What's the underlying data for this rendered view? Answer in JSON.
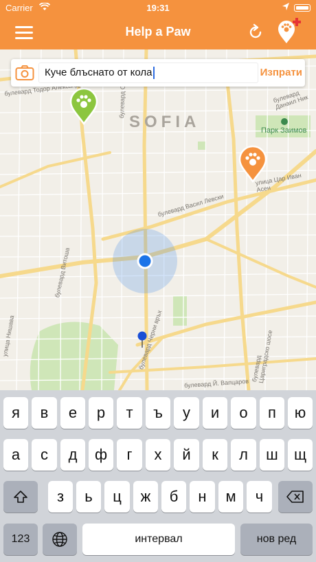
{
  "status_bar": {
    "carrier": "Carrier",
    "time": "19:31"
  },
  "nav": {
    "title": "Help a Paw"
  },
  "search": {
    "value": "Куче блъснато от кола",
    "send_label": "Изпрати"
  },
  "map": {
    "city_label": "SOFIA",
    "park_label": "Парк Заимов",
    "streets": {
      "todor_aleksandrov": "булевард Тодор Александров",
      "vasil_levski": "булевард Васил Левски",
      "tsar_ivan_asen": "улица Цар Иван Асен",
      "vitosha": "булевард Витоша",
      "nishava": "улица Нишава",
      "cherni_vrah": "булевард Черни връх",
      "y_vaptsarov": "булевард Й. Вапцаров",
      "danail_nikolaev": "булевард Данаил Ник",
      "tsarigradsko": "булевард Цариградско шосе",
      "slivnitsa": "булевард Сливница"
    },
    "markers": [
      {
        "kind": "paw",
        "color": "#8cc63f"
      },
      {
        "kind": "paw",
        "color": "#f5923e"
      }
    ]
  },
  "keyboard": {
    "row1": [
      "я",
      "в",
      "е",
      "р",
      "т",
      "ъ",
      "у",
      "и",
      "о",
      "п",
      "ю"
    ],
    "row2": [
      "а",
      "с",
      "д",
      "ф",
      "г",
      "х",
      "й",
      "к",
      "л",
      "ш",
      "щ"
    ],
    "row3": [
      "з",
      "ь",
      "ц",
      "ж",
      "б",
      "н",
      "м",
      "ч"
    ],
    "numbers_label": "123",
    "space_label": "интервал",
    "return_label": "нов ред"
  },
  "colors": {
    "brand": "#f5923e",
    "paw_green": "#8cc63f",
    "location_blue": "#1a73e8"
  }
}
